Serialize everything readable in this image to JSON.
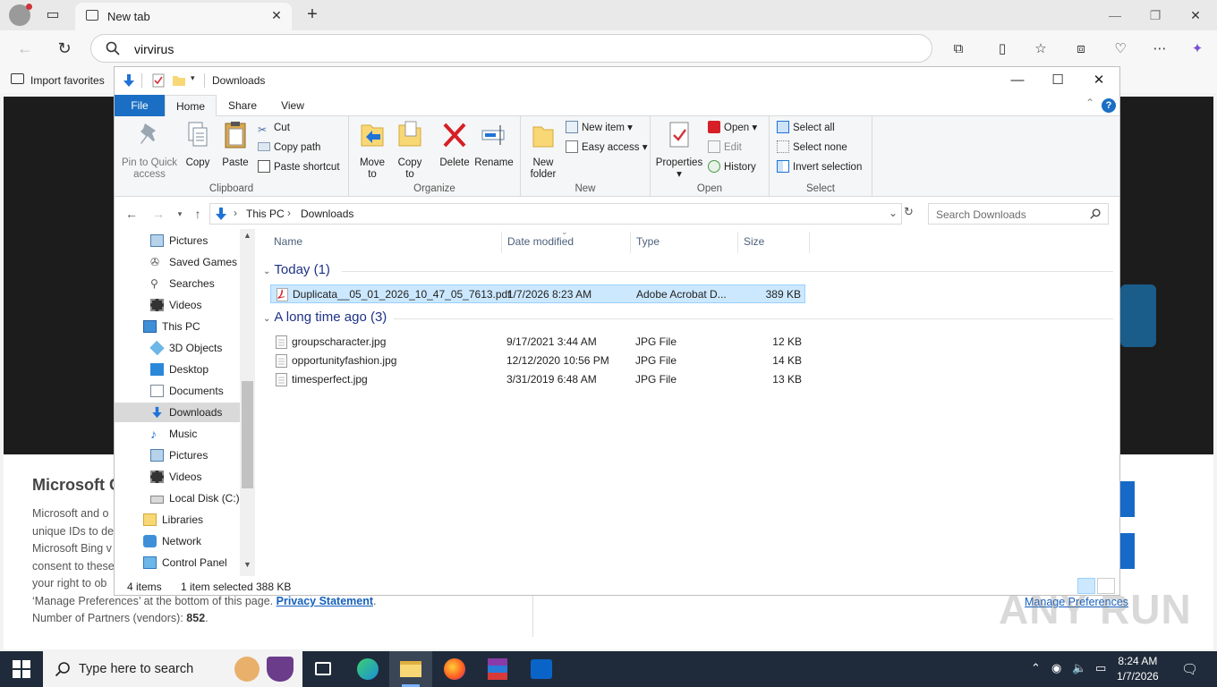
{
  "browser": {
    "tab_title": "New tab",
    "address_value": "virvirus",
    "favorites_import_label": "Import favorites"
  },
  "background_page": {
    "heading": "Microsoft C",
    "lines": [
      "Microsoft and o",
      "unique IDs to de",
      "Microsoft Bing v",
      "consent to these",
      "your right to ob"
    ],
    "manage_line_prefix": "‘Manage Preferences’ at the bottom of this page.",
    "privacy_link": "Privacy Statement",
    "privacy_suffix": ".",
    "partners_prefix": "Number of Partners (vendors): ",
    "partners_count": "852",
    "partners_suffix": ".",
    "manage_preferences": "Manage Preferences",
    "watermark": "ANY RUN"
  },
  "explorer": {
    "title": "Downloads",
    "ribbon_tabs": [
      "File",
      "Home",
      "Share",
      "View"
    ],
    "clipboard": {
      "pin_label_1": "Pin to Quick",
      "pin_label_2": "access",
      "copy": "Copy",
      "paste": "Paste",
      "cut": "Cut",
      "copy_path": "Copy path",
      "paste_shortcut": "Paste shortcut",
      "group": "Clipboard"
    },
    "organize": {
      "move_1": "Move",
      "move_2": "to",
      "copy_1": "Copy",
      "copy_2": "to",
      "delete": "Delete",
      "rename": "Rename",
      "group": "Organize"
    },
    "new": {
      "folder_1": "New",
      "folder_2": "folder",
      "new_item": "New item",
      "easy_access": "Easy access",
      "group": "New"
    },
    "open": {
      "properties": "Properties",
      "open": "Open",
      "edit": "Edit",
      "history": "History",
      "group": "Open"
    },
    "select": {
      "select_all": "Select all",
      "select_none": "Select none",
      "invert": "Invert selection",
      "group": "Select"
    },
    "breadcrumb": [
      "This PC",
      "Downloads"
    ],
    "search_placeholder": "Search Downloads",
    "nav_items": [
      {
        "label": "Pictures"
      },
      {
        "label": "Saved Games"
      },
      {
        "label": "Searches"
      },
      {
        "label": "Videos"
      },
      {
        "label": "This PC"
      },
      {
        "label": "3D Objects"
      },
      {
        "label": "Desktop"
      },
      {
        "label": "Documents"
      },
      {
        "label": "Downloads"
      },
      {
        "label": "Music"
      },
      {
        "label": "Pictures"
      },
      {
        "label": "Videos"
      },
      {
        "label": "Local Disk (C:)"
      },
      {
        "label": "Libraries"
      },
      {
        "label": "Network"
      },
      {
        "label": "Control Panel"
      }
    ],
    "columns": [
      "Name",
      "Date modified",
      "Type",
      "Size"
    ],
    "groups": [
      {
        "label": "Today (1)",
        "files": [
          {
            "name": "Duplicata__05_01_2026_10_47_05_7613.pdf",
            "date": "1/7/2026 8:23 AM",
            "type": "Adobe Acrobat D...",
            "size": "389 KB"
          }
        ]
      },
      {
        "label": "A long time ago (3)",
        "files": [
          {
            "name": "groupscharacter.jpg",
            "date": "9/17/2021 3:44 AM",
            "type": "JPG File",
            "size": "12 KB"
          },
          {
            "name": "opportunityfashion.jpg",
            "date": "12/12/2020 10:56 PM",
            "type": "JPG File",
            "size": "14 KB"
          },
          {
            "name": "timesperfect.jpg",
            "date": "3/31/2019 6:48 AM",
            "type": "JPG File",
            "size": "13 KB"
          }
        ]
      }
    ],
    "status": {
      "items": "4 items",
      "selected": "1 item selected",
      "size": "388 KB"
    }
  },
  "taskbar": {
    "search_text": "Type here to search",
    "time": "8:24 AM",
    "date": "1/7/2026"
  }
}
